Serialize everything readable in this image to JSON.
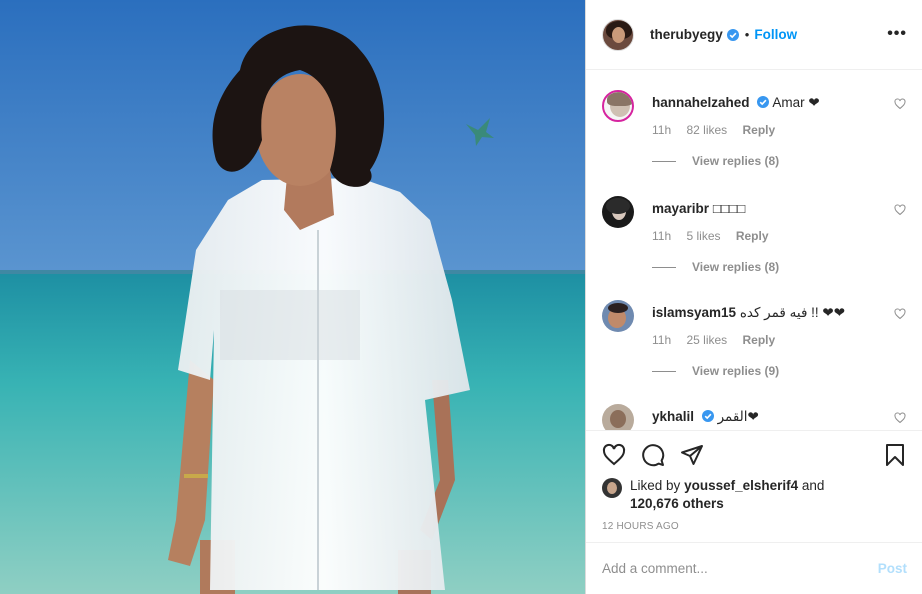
{
  "post": {
    "username": "therubyegy",
    "follow_label": "Follow",
    "dot": "•",
    "more": "•••"
  },
  "comments": [
    {
      "username": "hannahelzahed",
      "verified": true,
      "text": "Amar ❤",
      "time": "11h",
      "likes": "82 likes",
      "reply": "Reply",
      "view_replies": "View replies (8)"
    },
    {
      "username": "mayaribr",
      "verified": false,
      "text": "□□□□",
      "time": "11h",
      "likes": "5 likes",
      "reply": "Reply",
      "view_replies": "View replies (8)"
    },
    {
      "username": "islamsyam15",
      "verified": false,
      "text": "فيه قمر كده !! ❤❤",
      "time": "11h",
      "likes": "25 likes",
      "reply": "Reply",
      "view_replies": "View replies (9)"
    },
    {
      "username": "ykhalil",
      "verified": true,
      "text": "القمر❤",
      "time": "",
      "likes": "",
      "reply": "",
      "view_replies": ""
    }
  ],
  "likes": {
    "prefix": "Liked by",
    "user": "youssef_elsherif4",
    "and": "and",
    "count": "120,676 others"
  },
  "timestamp": "12 HOURS AGO",
  "add_comment": {
    "placeholder": "Add a comment...",
    "post_label": "Post"
  },
  "colors": {
    "accent": "#0095f6",
    "post_disabled": "#b2dffc",
    "muted": "#8e8e8e",
    "text": "#262626"
  }
}
